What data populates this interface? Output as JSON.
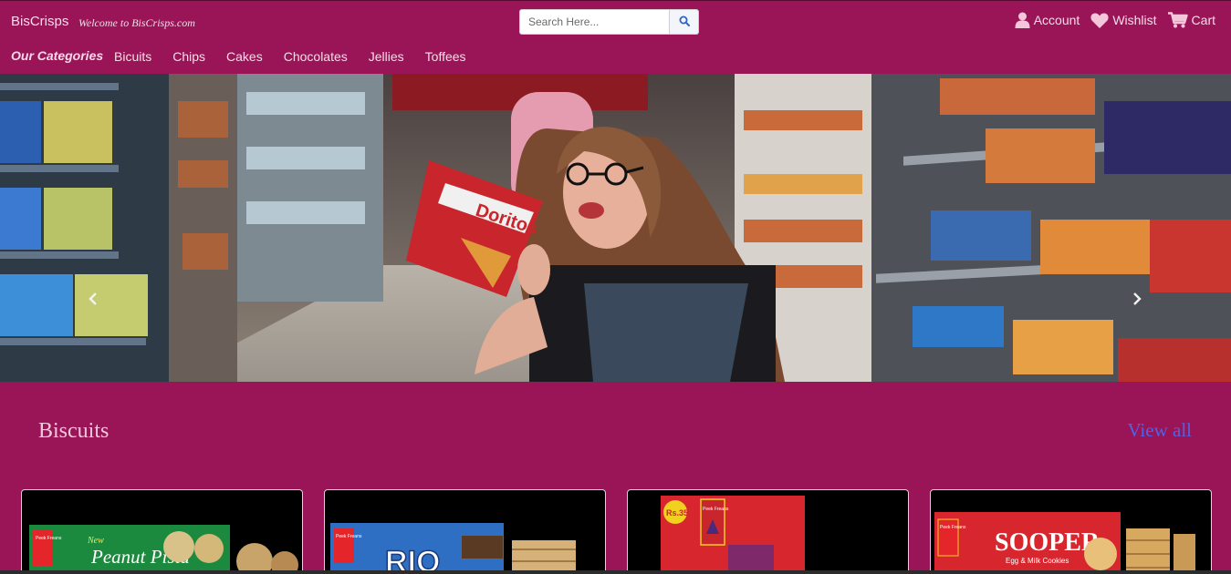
{
  "header": {
    "brand": "BisCrisps",
    "tagline": "Welcome to BisCrisps.com",
    "search_placeholder": "Search Here...",
    "icons": {
      "search": "search-icon",
      "account": "user-icon",
      "wishlist": "heart-icon",
      "cart": "cart-icon"
    },
    "nav": {
      "account": "Account",
      "wishlist": "Wishlist",
      "cart": "Cart"
    }
  },
  "categories": {
    "title": "Our Categories",
    "items": [
      "Bicuits",
      "Chips",
      "Cakes",
      "Chocolates",
      "Jellies",
      "Toffees"
    ]
  },
  "hero": {
    "product_text": "Doritos",
    "icons": {
      "prev": "chevron-left-icon",
      "next": "chevron-right-icon"
    }
  },
  "section": {
    "title": "Biscuits",
    "view_all": "View all"
  },
  "products": [
    {
      "brand": "Peek Freans",
      "badge": "New",
      "name": "Peanut Pista"
    },
    {
      "brand": "Peek Freans",
      "name": "RIO"
    },
    {
      "brand": "Peek Freans",
      "price_badge": "Rs.35"
    },
    {
      "brand": "Peek Freans",
      "name": "SOOPER",
      "subtitle": "Egg & Milk Cookies"
    }
  ],
  "colors": {
    "background": "#991558",
    "link": "#4c64e6",
    "text": "#f7dbe8"
  }
}
